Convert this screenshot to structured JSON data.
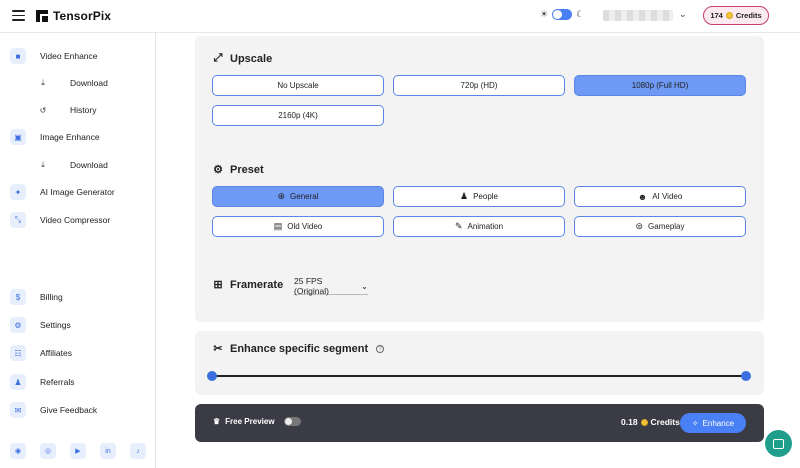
{
  "brand": {
    "name": "TensorPix"
  },
  "header": {
    "credits_value": "174",
    "credits_label": "Credits"
  },
  "sidebar": {
    "items": [
      {
        "label": "Video Enhance",
        "icon": "video-icon"
      },
      {
        "label": "Download",
        "icon": "download-icon"
      },
      {
        "label": "History",
        "icon": "history-icon"
      },
      {
        "label": "Image Enhance",
        "icon": "image-icon"
      },
      {
        "label": "Download",
        "icon": "download-icon"
      },
      {
        "label": "AI Image Generator",
        "icon": "magic-icon"
      },
      {
        "label": "Video Compressor",
        "icon": "compress-icon"
      },
      {
        "label": "Billing",
        "icon": "dollar-icon"
      },
      {
        "label": "Settings",
        "icon": "gear-icon"
      },
      {
        "label": "Affiliates",
        "icon": "group-icon"
      },
      {
        "label": "Referrals",
        "icon": "users-icon"
      },
      {
        "label": "Give Feedback",
        "icon": "chat-icon"
      }
    ],
    "socials": [
      "discord-icon",
      "instagram-icon",
      "youtube-icon",
      "linkedin-icon",
      "tiktok-icon"
    ]
  },
  "upscale": {
    "title": "Upscale",
    "options": [
      "No Upscale",
      "720p (HD)",
      "1080p (Full HD)",
      "2160p (4K)"
    ],
    "selected": "1080p (Full HD)"
  },
  "preset": {
    "title": "Preset",
    "options": [
      "General",
      "People",
      "AI Video",
      "Old Video",
      "Animation",
      "Gameplay"
    ],
    "selected": "General"
  },
  "framerate": {
    "title": "Framerate",
    "value": "25 FPS (Original)"
  },
  "segment": {
    "title": "Enhance specific segment",
    "start_fraction": 0,
    "end_fraction": 1
  },
  "bottom": {
    "preview_label": "Free Preview",
    "preview_on": false,
    "cost_value": "0.18",
    "cost_label": "Credits",
    "enhance_label": "Enhance"
  },
  "colors": {
    "accent": "#4a80f5",
    "selected_option": "#6e99f5",
    "credits_border": "#c9406a",
    "bar": "#3b3b45",
    "chat": "#1f9e8c"
  }
}
